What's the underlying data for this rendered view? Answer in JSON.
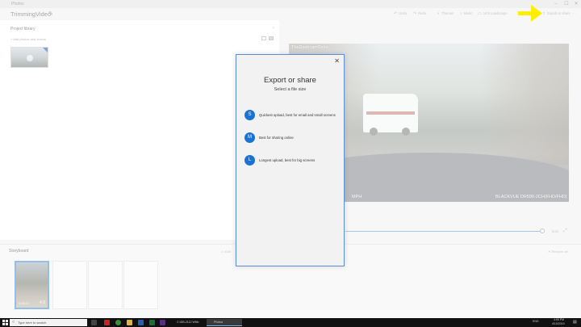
{
  "titlebar": {
    "app_name": "Photos",
    "minimize": "–",
    "maximize": "☐",
    "close": "✕"
  },
  "header": {
    "project_title": "TrimmingVideo",
    "toolbar": [
      {
        "label": "Undo",
        "icon": "undo-icon",
        "glyph": "↶"
      },
      {
        "label": "Redo",
        "icon": "redo-icon",
        "glyph": "↷"
      },
      {
        "label": "Themes",
        "icon": "palette-icon",
        "glyph": "◐"
      },
      {
        "label": "Music",
        "icon": "music-icon",
        "glyph": "♪"
      },
      {
        "label": "16:9 Landscape",
        "icon": "aspect-ratio-icon",
        "glyph": "▭"
      },
      {
        "label": "Export or share",
        "icon": "export-icon",
        "glyph": "⇪"
      }
    ],
    "more": "···"
  },
  "library": {
    "title": "Project library",
    "add_label": "+ Add photos and videos",
    "collapse": "‹"
  },
  "video": {
    "watermark": "TheDashcamStore",
    "speed_unit": "MPH",
    "camera_label": "BLACKVUE  DR590-2CH(FHD/FHD)",
    "end_time": "0:23"
  },
  "storyboard": {
    "title": "Storyboard",
    "edit": "Edit",
    "remove_all": "Remove all",
    "clip": {
      "time": "0:00:17",
      "duration": "4.0"
    }
  },
  "dialog": {
    "close": "✕",
    "title": "Export or share",
    "subtitle": "Select a file size",
    "options": [
      {
        "badge": "S",
        "label": "Quickest upload, best for email and small screens"
      },
      {
        "badge": "M",
        "label": "Best for sharing online"
      },
      {
        "badge": "L",
        "label": "Longest upload, best for big screens"
      }
    ]
  },
  "taskbar": {
    "search_placeholder": "Type here to search",
    "windows": [
      {
        "label": "C:\\DB-2112 WNb",
        "active": false
      },
      {
        "label": "Photos",
        "active": true
      }
    ],
    "time": "4:55 PM",
    "date": "4/10/2019",
    "lang": "ENG"
  },
  "colors": {
    "accent": "#1a73d3",
    "arrow": "#ffee00"
  }
}
